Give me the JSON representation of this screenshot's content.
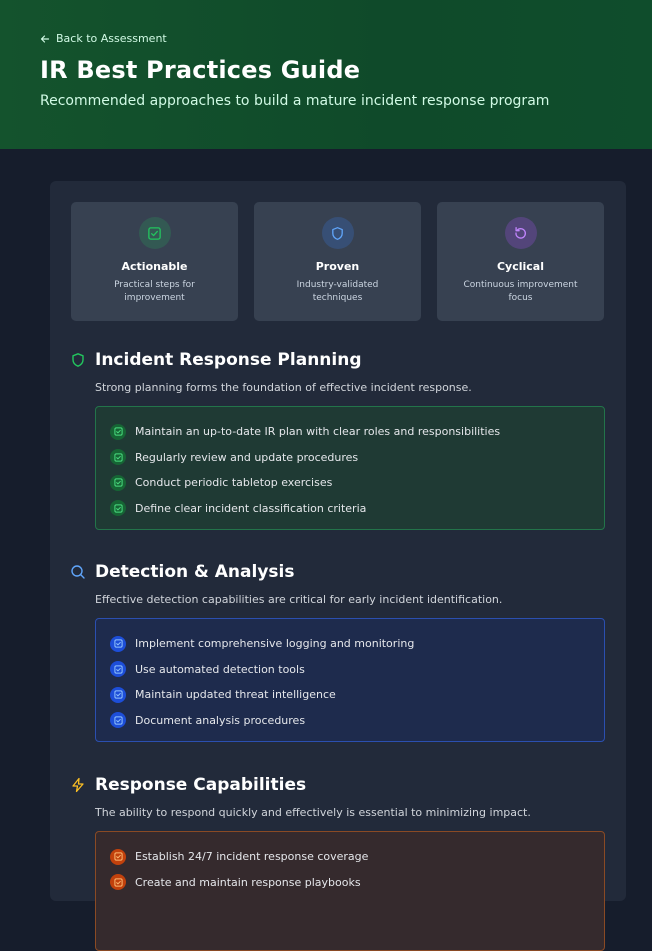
{
  "header": {
    "back_label": "Back to Assessment",
    "title": "IR Best Practices Guide",
    "subtitle": "Recommended approaches to build a mature incident response program"
  },
  "features": [
    {
      "icon": "check-square-icon",
      "title": "Actionable",
      "desc": "Practical steps for improvement",
      "color": "#22c55e"
    },
    {
      "icon": "shield-icon",
      "title": "Proven",
      "desc": "Industry-validated techniques",
      "color": "#3b82f6"
    },
    {
      "icon": "rotate-ccw-icon",
      "title": "Cyclical",
      "desc": "Continuous improvement focus",
      "color": "#a855f7"
    }
  ],
  "sections": [
    {
      "icon": "shield-icon",
      "title": "Incident Response Planning",
      "desc": "Strong planning forms the foundation of effective incident response.",
      "accent": "#22c55e",
      "items": [
        "Maintain an up-to-date IR plan with clear roles and responsibilities",
        "Regularly review and update procedures",
        "Conduct periodic tabletop exercises",
        "Define clear incident classification criteria"
      ]
    },
    {
      "icon": "search-icon",
      "title": "Detection & Analysis",
      "desc": "Effective detection capabilities are critical for early incident identification.",
      "accent": "#3b82f6",
      "items": [
        "Implement comprehensive logging and monitoring",
        "Use automated detection tools",
        "Maintain updated threat intelligence",
        "Document analysis procedures"
      ]
    },
    {
      "icon": "lightning-icon",
      "title": "Response Capabilities",
      "desc": "The ability to respond quickly and effectively is essential to minimizing impact.",
      "accent": "#f97316",
      "items": [
        "Establish 24/7 incident response coverage",
        "Create and maintain response playbooks"
      ]
    }
  ]
}
